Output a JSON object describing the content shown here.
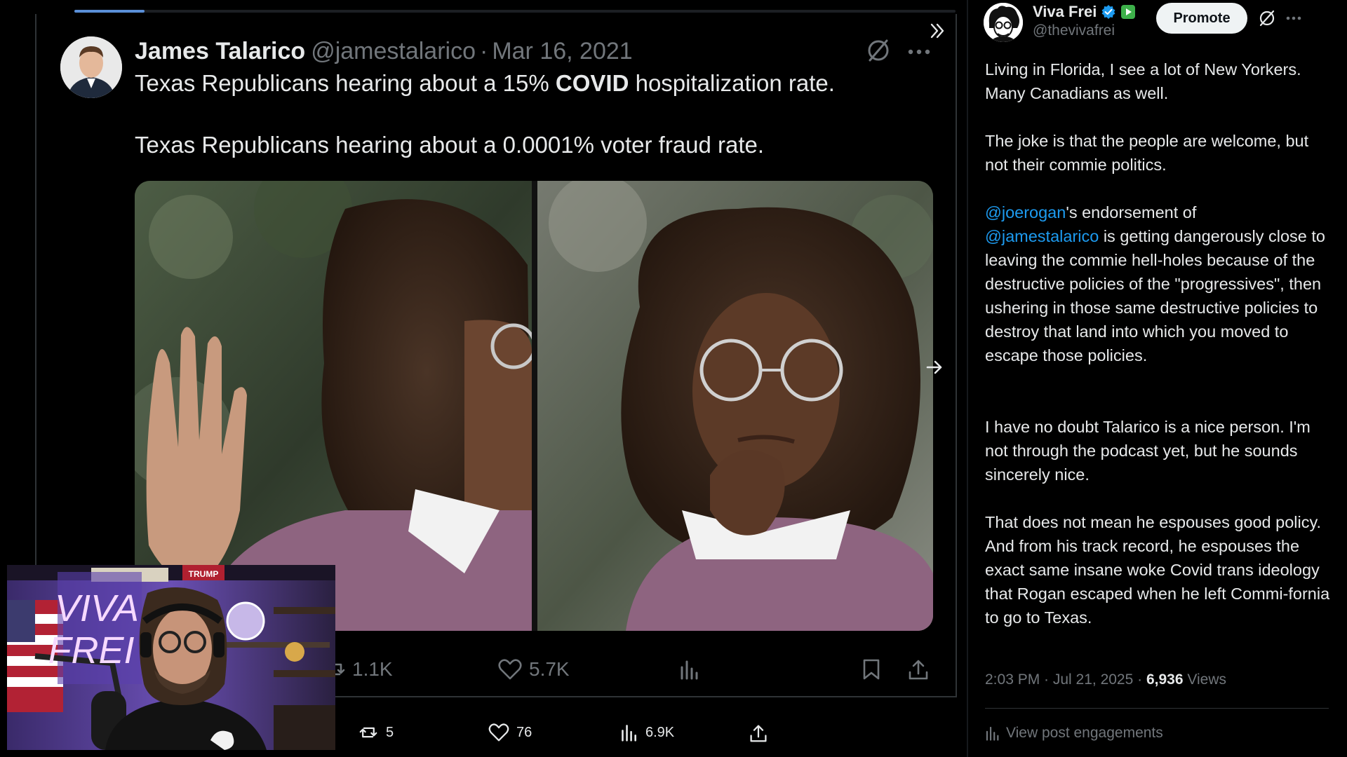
{
  "viewer": {
    "progress": 0.08,
    "original_tweet": {
      "author_name": "James Talarico",
      "author_handle": "@jamestalarico",
      "separator": "·",
      "date": "Mar 16, 2021",
      "line1_pre": "Texas Republicans hearing about a 15% ",
      "line1_bold": "COVID",
      "line1_post": " hospitalization rate.",
      "line2": "Texas Republicans hearing about a 0.0001% voter fraud rate."
    },
    "actions": {
      "retweets": "1.1K",
      "likes": "5.7K"
    },
    "quote_actions": {
      "retweets": "5",
      "likes": "76",
      "views": "6.9K"
    }
  },
  "webcam": {
    "sign_line1": "VIVA",
    "sign_line2": "FREI",
    "poster": "TRUMP"
  },
  "right": {
    "author_name": "Viva Frei",
    "author_handle": "@thevivafrei",
    "promote_label": "Promote",
    "para1": "Living in Florida, I see a lot of New Yorkers. Many Canadians as well.",
    "para2": "The joke is that the people are welcome, but not their commie politics.",
    "mention1": "@joerogan",
    "para3_mid": "'s endorsement of",
    "mention2": "@jamestalarico",
    "para3_rest": " is getting dangerously close to leaving the commie hell-holes because of the destructive policies of the \"progressives\", then ushering in those same destructive policies to destroy that land into which you moved to escape those policies.",
    "para4": "I have no doubt Talarico is a nice person. I'm not through the podcast yet, but he sounds sincerely nice.",
    "para5": "That does not mean he espouses good policy. And from his track record, he espouses the exact same insane woke Covid trans ideology that Rogan escaped when he left Commi-fornia to go to Texas.",
    "time": "2:03 PM · Jul 21, 2025 · ",
    "views_count": "6,936",
    "views_label": " Views",
    "engagements_label": "View post engagements"
  },
  "colors": {
    "accent": "#1d9bf0",
    "muted": "#71767b",
    "text": "#e7e9ea",
    "verified_badge": "#1d9bf0",
    "subscription_badge": "#3db04a"
  },
  "icons": [
    "close-icon",
    "collapse-icon",
    "grok-icon",
    "more-icon",
    "arrow-right-icon",
    "retweet-icon",
    "heart-icon",
    "views-icon",
    "bookmark-icon",
    "share-icon",
    "verified-icon",
    "subscription-icon",
    "engagements-icon"
  ]
}
